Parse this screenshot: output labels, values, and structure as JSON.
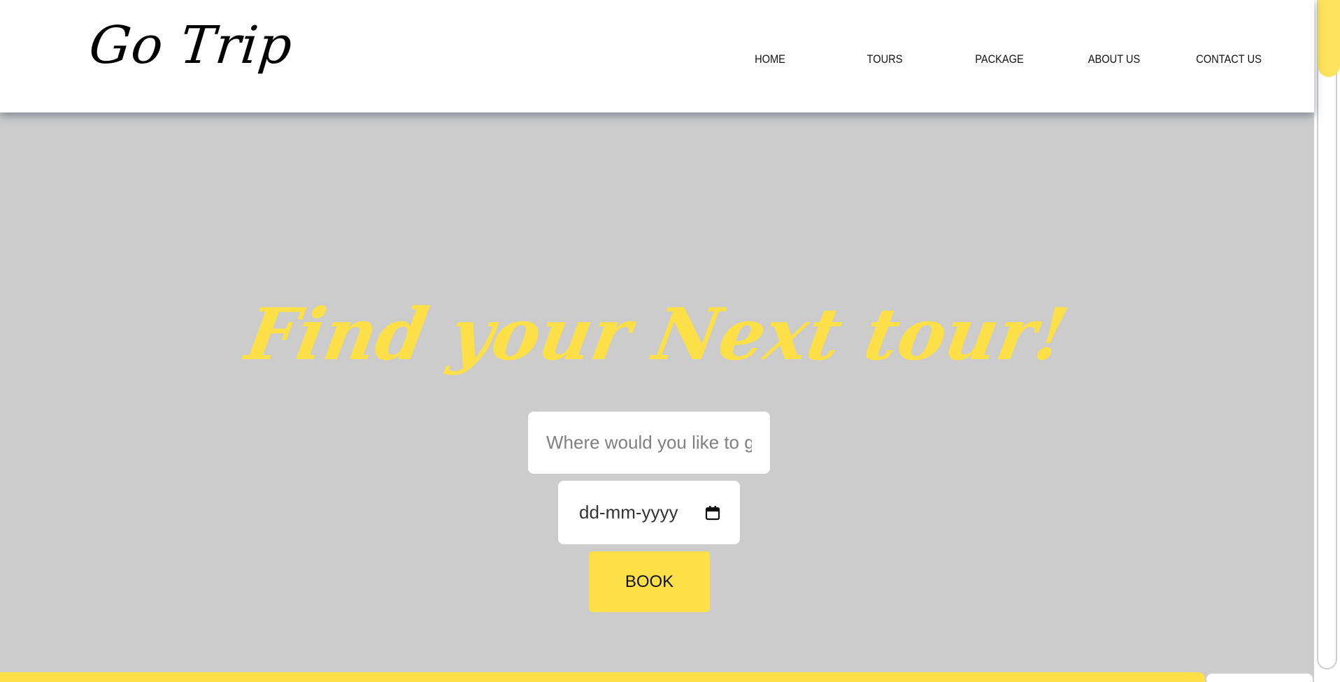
{
  "brand": {
    "logo_text": "Go Trip"
  },
  "nav": {
    "items": [
      {
        "label": "HOME"
      },
      {
        "label": "TOURS"
      },
      {
        "label": "PACKAGE"
      },
      {
        "label": "ABOUT US"
      },
      {
        "label": "CONTACT US"
      }
    ]
  },
  "hero": {
    "title": "Find your Next tour!",
    "destination_placeholder": "Where would you like to go?",
    "date_value": "dd-mm-yyyy",
    "book_label": "BOOK"
  },
  "colors": {
    "accent": "#fde047",
    "hero_background": "#cccccc",
    "header_background": "#ffffff"
  },
  "icons": {
    "date_picker": "calendar-icon"
  }
}
